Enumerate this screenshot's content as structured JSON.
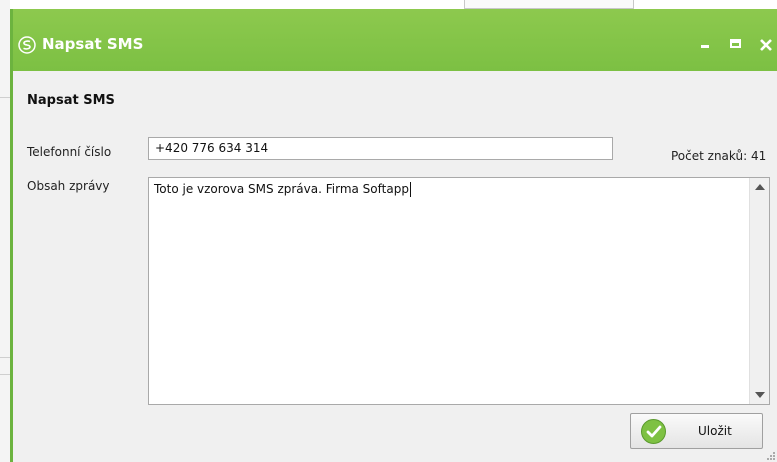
{
  "window": {
    "title": "Napsat SMS"
  },
  "form": {
    "section_title": "Napsat SMS",
    "phone_label": "Telefonní číslo",
    "phone_value": "+420 776 634 314",
    "body_label": "Obsah zprávy",
    "body_value": "Toto je vzorova SMS zpráva. Firma Softapp",
    "char_count_text": "Počet znaků: 41"
  },
  "actions": {
    "save_label": "Uložit"
  },
  "icons": {
    "app": "softapp-logo-icon",
    "minimize": "minimize-icon",
    "maximize": "maximize-icon",
    "close": "close-icon",
    "scroll_up": "scroll-up-arrow-icon",
    "scroll_down": "scroll-down-arrow-icon",
    "save": "checkmark-icon"
  },
  "colors": {
    "titlebar": "#7cc043",
    "accent_border": "#6cb33f",
    "save_icon": "#7ec143"
  }
}
